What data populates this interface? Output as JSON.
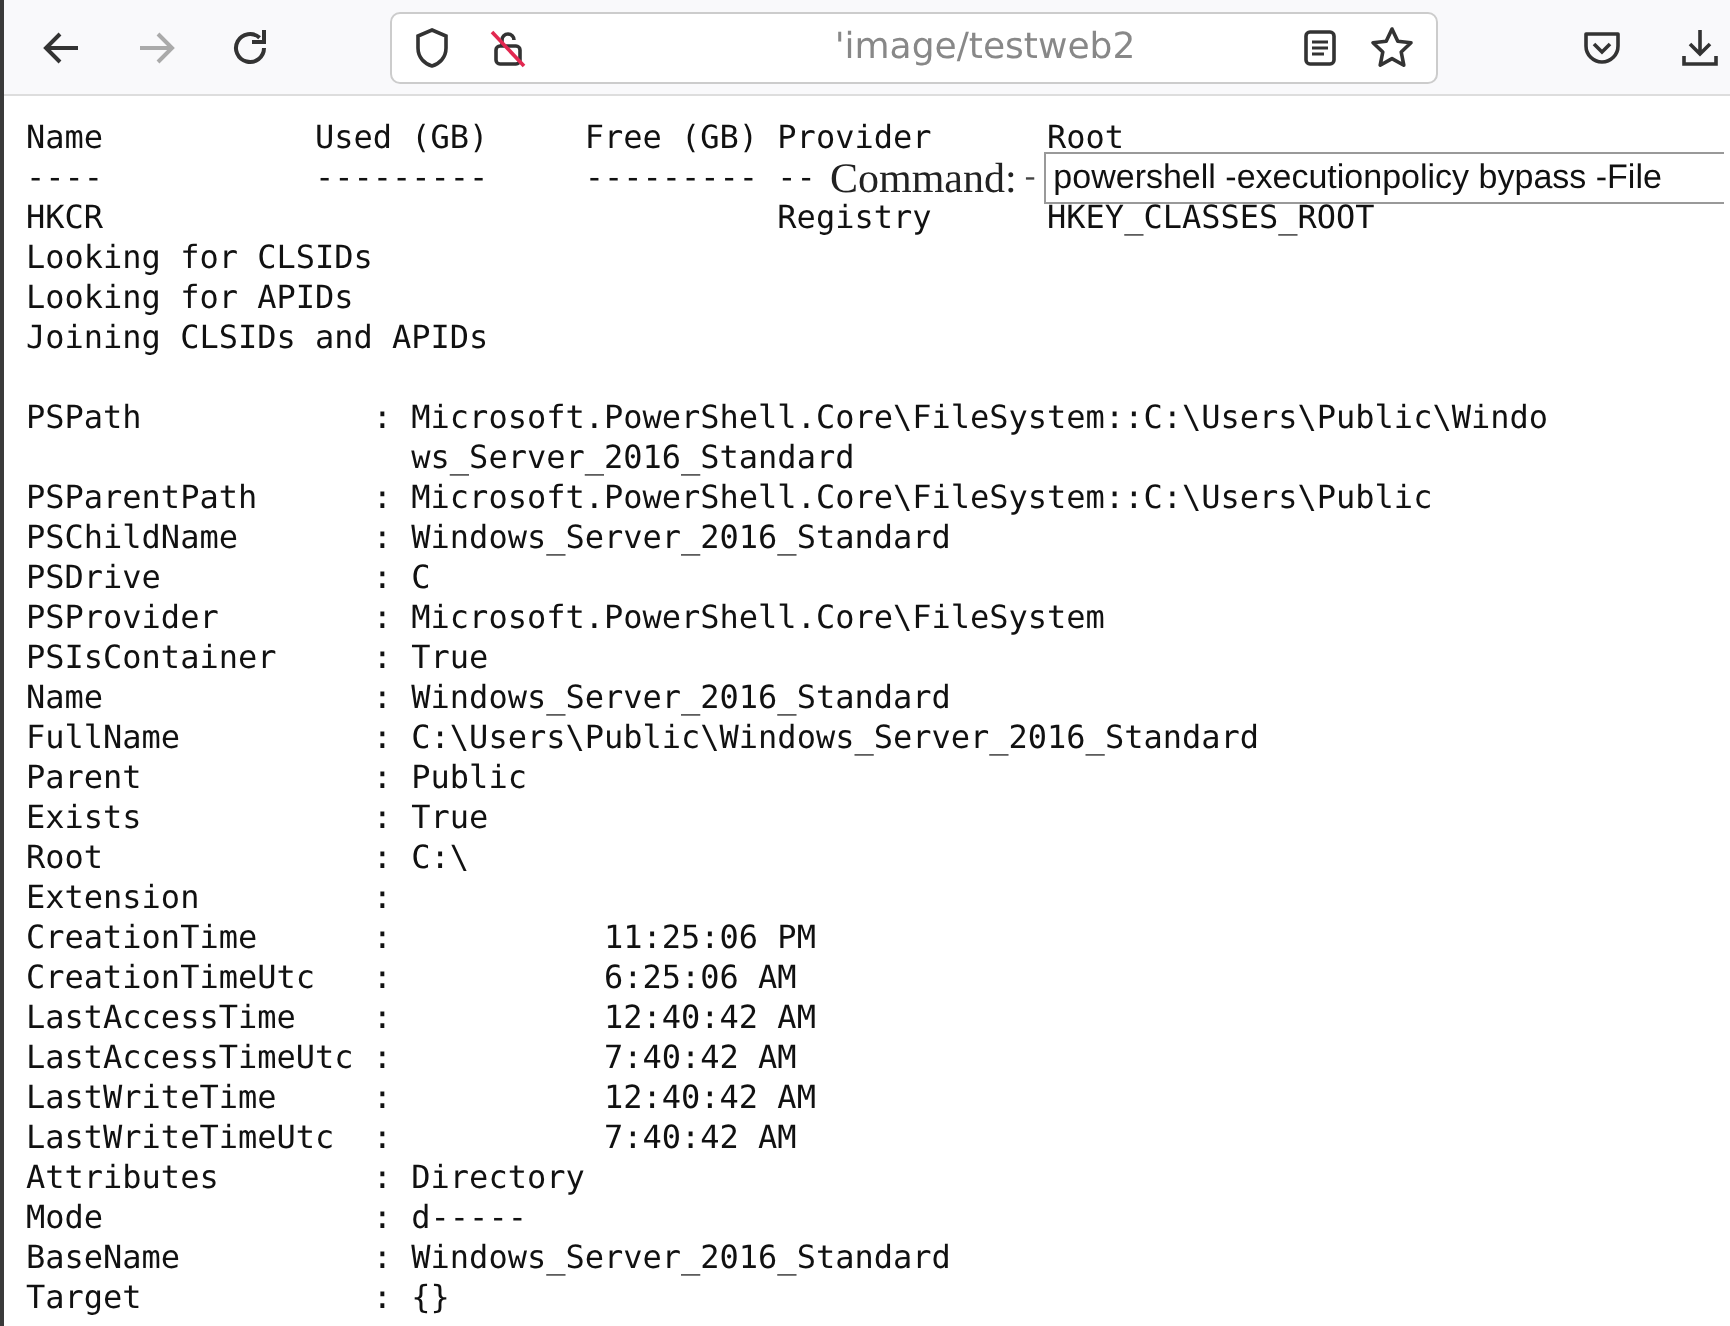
{
  "toolbar": {
    "back_enabled": true,
    "forward_enabled": false,
    "url": "'image/testweb2"
  },
  "drives_table": {
    "columns": [
      {
        "heading": "Name",
        "rule": "----"
      },
      {
        "heading": "Used (GB)",
        "rule": "---------"
      },
      {
        "heading": "Free (GB)",
        "rule": "---------"
      },
      {
        "heading": "Provider",
        "rule": "--"
      },
      {
        "heading": "Root"
      }
    ],
    "rows": [
      {
        "name": "HKCR",
        "provider": "Registry",
        "root": "HKEY_CLASSES_ROOT"
      }
    ]
  },
  "command_overlay": {
    "label": "Command:",
    "dash": "-",
    "value": "powershell -executionpolicy bypass -File"
  },
  "log_lines": [
    "Looking for CLSIDs",
    "Looking for APIDs",
    "Joining CLSIDs and APIDs"
  ],
  "properties": [
    {
      "key": "PSPath",
      "value": "Microsoft.PowerShell.Core\\FileSystem::C:\\Users\\Public\\Windo",
      "continuation": "ws_Server_2016_Standard"
    },
    {
      "key": "PSParentPath",
      "value": "Microsoft.PowerShell.Core\\FileSystem::C:\\Users\\Public"
    },
    {
      "key": "PSChildName",
      "value": "Windows_Server_2016_Standard"
    },
    {
      "key": "PSDrive",
      "value": "C"
    },
    {
      "key": "PSProvider",
      "value": "Microsoft.PowerShell.Core\\FileSystem"
    },
    {
      "key": "PSIsContainer",
      "value": "True"
    },
    {
      "key": "Name",
      "value": "Windows_Server_2016_Standard"
    },
    {
      "key": "FullName",
      "value": "C:\\Users\\Public\\Windows_Server_2016_Standard"
    },
    {
      "key": "Parent",
      "value": "Public"
    },
    {
      "key": "Exists",
      "value": "True"
    },
    {
      "key": "Root",
      "value": "C:\\"
    },
    {
      "key": "Extension"
    },
    {
      "key": "CreationTime",
      "value": "          11:25:06 PM"
    },
    {
      "key": "CreationTimeUtc",
      "value": "          6:25:06 AM"
    },
    {
      "key": "LastAccessTime",
      "value": "          12:40:42 AM"
    },
    {
      "key": "LastAccessTimeUtc",
      "value": "          7:40:42 AM"
    },
    {
      "key": "LastWriteTime",
      "value": "          12:40:42 AM"
    },
    {
      "key": "LastWriteTimeUtc",
      "value": "          7:40:42 AM"
    },
    {
      "key": "Attributes",
      "value": "Directory"
    },
    {
      "key": "Mode",
      "value": "d-----"
    },
    {
      "key": "BaseName",
      "value": "Windows_Server_2016_Standard"
    },
    {
      "key": "Target",
      "value": "{}"
    }
  ],
  "separator": ":"
}
